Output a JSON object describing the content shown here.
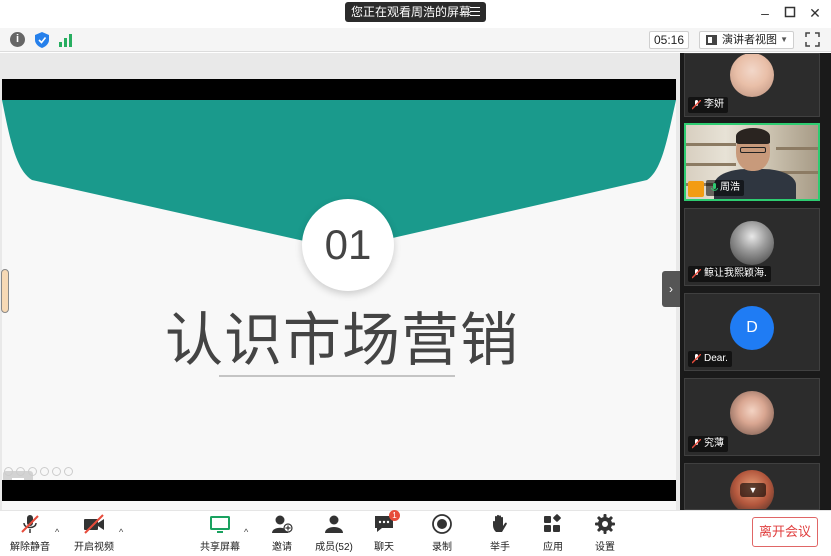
{
  "titlebar": {
    "share_notice": "您正在观看周浩的屏幕"
  },
  "toprow": {
    "timer": "05:16",
    "view_mode": "演讲者视图"
  },
  "slide": {
    "number": "01",
    "title": "认识市场营销"
  },
  "gallery": {
    "participants": [
      {
        "name": "李妍",
        "type": "photo",
        "muted": true
      },
      {
        "name": "周浩",
        "type": "video",
        "muted": false,
        "active": true
      },
      {
        "name": "鲸让我熙颖海.",
        "type": "photo",
        "muted": true
      },
      {
        "name": "Dear.",
        "type": "letter",
        "letter": "D",
        "muted": true
      },
      {
        "name": "究薄",
        "type": "photo",
        "muted": true
      }
    ]
  },
  "toolbar": {
    "unmute": "解除静音",
    "start_video": "开启视频",
    "share_screen": "共享屏幕",
    "invite": "邀请",
    "members": "成员(52)",
    "chat": "聊天",
    "chat_badge": "1",
    "record": "录制",
    "raise_hand": "举手",
    "apps": "应用",
    "settings": "设置",
    "leave": "离开会议"
  },
  "colors": {
    "teal": "#1a9a8c",
    "accent_green": "#2ecc71",
    "leave_red": "#e03e3e",
    "avatar_blue": "#1f7cf4"
  }
}
